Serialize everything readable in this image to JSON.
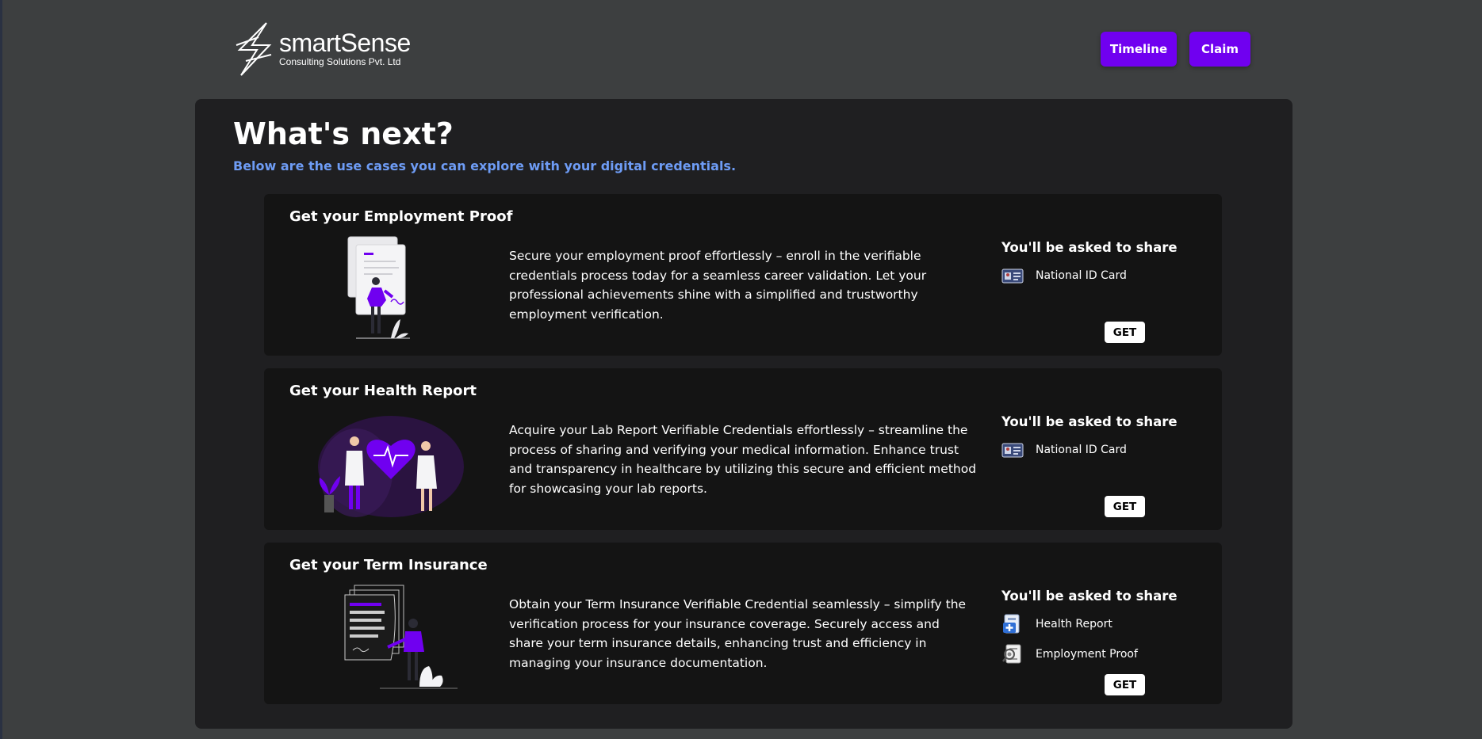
{
  "header": {
    "logo_name": "smartSense",
    "logo_sub": "Consulting Solutions Pvt. Ltd",
    "timeline_label": "Timeline",
    "claim_label": "Claim"
  },
  "main": {
    "title": "What's next?",
    "subtitle": "Below are the use cases you can explore with your digital credentials.",
    "cards": [
      {
        "title": "Get your Employment Proof",
        "description": "Secure your employment proof effortlessly – enroll in the verifiable credentials process today for a seamless career validation. Let your professional achievements shine with a simplified and trustworthy employment verification.",
        "share_title": "You'll be asked to share",
        "share_items": [
          {
            "label": "National ID Card",
            "icon": "id-card-icon"
          }
        ],
        "button_label": "GET",
        "illustration": "employment-illustration"
      },
      {
        "title": "Get your Health Report",
        "description": "Acquire your Lab Report Verifiable Credentials effortlessly – streamline the process of sharing and verifying your medical information. Enhance trust and transparency in healthcare by utilizing this secure and efficient method for showcasing your lab reports.",
        "share_title": "You'll be asked to share",
        "share_items": [
          {
            "label": "National ID Card",
            "icon": "id-card-icon"
          }
        ],
        "button_label": "GET",
        "illustration": "health-illustration"
      },
      {
        "title": "Get your Term Insurance",
        "description": "Obtain your Term Insurance Verifiable Credential seamlessly – simplify the verification process for your insurance coverage. Securely access and share your term insurance details, enhancing trust and efficiency in managing your insurance documentation.",
        "share_title": "You'll be asked to share",
        "share_items": [
          {
            "label": "Health Report",
            "icon": "health-report-icon"
          },
          {
            "label": "Employment Proof",
            "icon": "employment-proof-icon"
          }
        ],
        "button_label": "GET",
        "illustration": "insurance-illustration"
      }
    ]
  },
  "colors": {
    "background": "#3d3f40",
    "panel": "#1f1f21",
    "card": "#141414",
    "accent": "#7000f0",
    "subtitle": "#6e9cf5"
  }
}
